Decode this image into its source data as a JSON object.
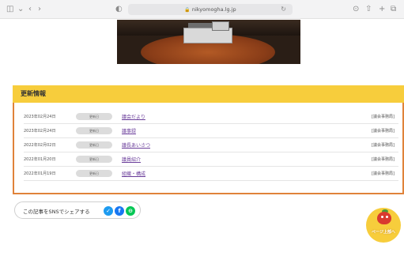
{
  "browser": {
    "url": "nikyomogha.lg.jp"
  },
  "update_section": {
    "heading": "更新情報",
    "rows": [
      {
        "date": "2023年02月24日",
        "badge": "更新日",
        "title": "議会だより",
        "category": "[議会事務局]"
      },
      {
        "date": "2023年02月24日",
        "badge": "更新日",
        "title": "議事録",
        "category": "[議会事務局]"
      },
      {
        "date": "2022年02月02日",
        "badge": "更新日",
        "title": "議長あいさつ",
        "category": "[議会事務局]"
      },
      {
        "date": "2022年01月20日",
        "badge": "更新日",
        "title": "議員紹介",
        "category": "[議会事務局]"
      },
      {
        "date": "2022年01月19日",
        "badge": "更新日",
        "title": "組織・構成",
        "category": "[議会事務局]"
      }
    ]
  },
  "share": {
    "label": "この記事をSNSでシェアする",
    "icons": [
      "twitter-icon",
      "facebook-icon",
      "line-icon"
    ],
    "colors": {
      "twitter": "#1d9bf0",
      "facebook": "#1877f2",
      "line": "#06c755"
    }
  },
  "page_top": {
    "label": "ページ上部へ"
  },
  "colors": {
    "accent_yellow": "#f7cd3c",
    "box_border": "#e0833a",
    "link": "#6a3d9a"
  }
}
